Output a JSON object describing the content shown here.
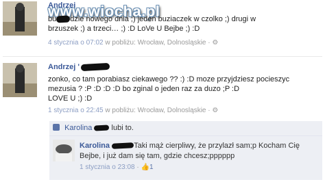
{
  "post1": {
    "author": "Andrzej",
    "text_line1_prefix": "bu",
    "text_line1": "dzie nowego dnia ;) jeden buziaczek w czolko ;) drugi w",
    "text_line2": "brzuszek ;) a trzeci… ;) :D LoVe U Bejbe ;) :D",
    "time": "4 stycznia o 07:02",
    "location": "w pobliżu: Wrocław, Dolnosląskie",
    "separator": "·",
    "gear_icon": "gear-icon"
  },
  "post2": {
    "author": "Andrzej",
    "author_suffix": "'",
    "lines": [
      "zonko, co tam porabiasz ciekawego ?? :) :D moze przyjdziesz pocieszyc",
      "mezusia ? :P :D :D :D bo zginal o jeden raz za duzo ;P :D",
      "LOVE U ;) :D"
    ],
    "time": "1 stycznia o 22:45",
    "location": "w pobliżu: Wrocław, Dolnosląskie",
    "separator": "·",
    "gear_icon": "gear-icon"
  },
  "likes": {
    "icon": "thumbs-up-icon",
    "name": "Karolina",
    "suffix": "lubi to."
  },
  "reply": {
    "author": "Karolina",
    "line1": "Taki mąż cierpliwy, że przylazł sam;p Kocham Cię",
    "line2": "Bejbe, i już dam się tam, gdzie chcesz;pppppp",
    "time": "1 stycznia o 23:08",
    "separator": "·",
    "like_count": "1",
    "like_icon": "thumbs-up-icon"
  },
  "watermark": {
    "text": "www.wiocha.pl"
  }
}
